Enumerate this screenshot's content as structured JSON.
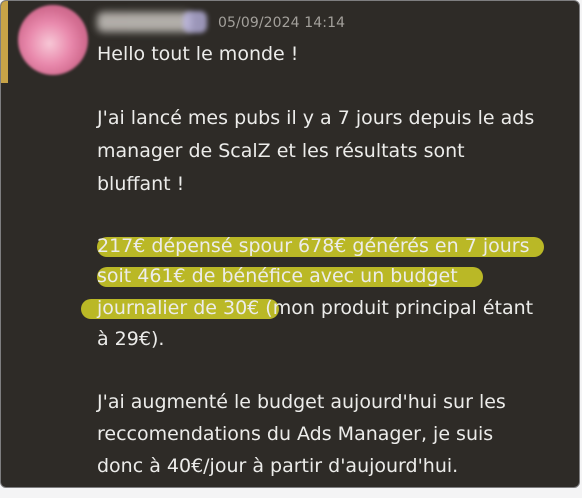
{
  "message": {
    "timestamp": "05/09/2024 14:14",
    "lines": [
      "Hello tout le monde !",
      "J'ai lancé mes pubs il y a 7 jours depuis le ads",
      "manager de ScalZ et les résultats sont",
      "bluffant !",
      "217€ dépensé spour 678€ générés en 7 jours",
      "soit 461€ de bénéfice avec un budget",
      "journalier de 30€",
      " (mon produit principal étant",
      "à 29€).",
      "J'ai augmenté le budget aujourd'hui sur les",
      "reccomendations du Ads Manager, je suis",
      "donc à 40€/jour à partir d'aujourd'hui."
    ]
  },
  "colors": {
    "background": "#2e2b27",
    "text": "#ececea",
    "timestamp": "#a3a09b",
    "highlight": "#c7c426",
    "mention_bar": "#c7a347"
  },
  "icons": {
    "avatar": "user-avatar-blurred",
    "badge": "role-badge-blurred"
  }
}
